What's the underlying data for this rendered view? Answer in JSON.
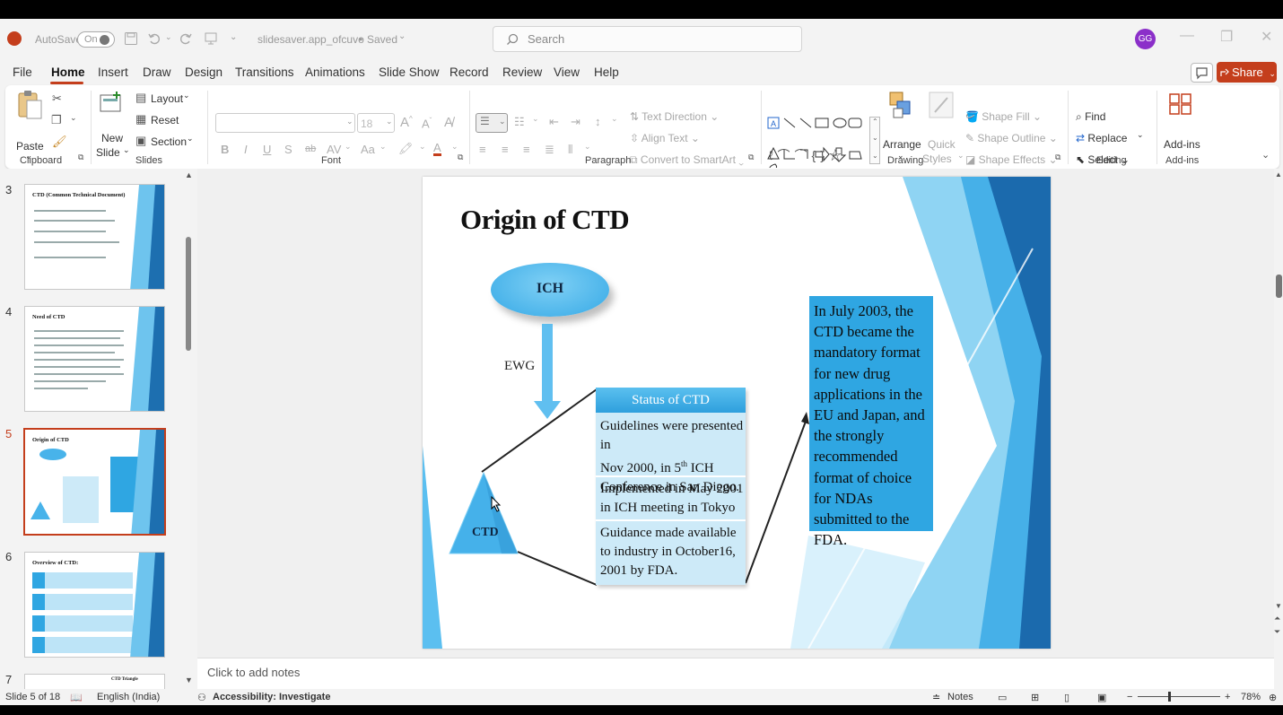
{
  "titlebar": {
    "autosave_label": "AutoSave",
    "autosave_state": "On",
    "filename": "slidesaver.app_ofcuvo",
    "save_status": "Saved",
    "search_placeholder": "Search",
    "user_initials": "GG"
  },
  "menu": {
    "items": [
      "File",
      "Home",
      "Insert",
      "Draw",
      "Design",
      "Transitions",
      "Animations",
      "Slide Show",
      "Record",
      "Review",
      "View",
      "Help"
    ],
    "active": "Home",
    "share_label": "Share"
  },
  "ribbon": {
    "clipboard": {
      "paste": "Paste",
      "group": "Clipboard"
    },
    "slides": {
      "new_slide_1": "New",
      "new_slide_2": "Slide",
      "layout": "Layout",
      "reset": "Reset",
      "section": "Section",
      "group": "Slides"
    },
    "font": {
      "size": "18",
      "bold": "B",
      "italic": "I",
      "underline": "U",
      "shadow": "S",
      "strike": "ab",
      "spacing": "AV",
      "case": "Aa",
      "color": "A",
      "group": "Font"
    },
    "paragraph": {
      "text_direction": "Text Direction",
      "align_text": "Align Text",
      "convert_smartart": "Convert to SmartArt",
      "group": "Paragraph"
    },
    "drawing": {
      "arrange": "Arrange",
      "quick_styles_1": "Quick",
      "quick_styles_2": "Styles",
      "shape_fill": "Shape Fill",
      "shape_outline": "Shape Outline",
      "shape_effects": "Shape Effects",
      "group": "Drawing"
    },
    "editing": {
      "find": "Find",
      "replace": "Replace",
      "select": "Select",
      "group": "Editing"
    },
    "addins": {
      "label": "Add-ins",
      "group": "Add-ins"
    }
  },
  "thumbnails": [
    {
      "num": "3",
      "title": "CTD (Common Technical Document)"
    },
    {
      "num": "4",
      "title": "Need of CTD"
    },
    {
      "num": "5",
      "title": "Origin of CTD"
    },
    {
      "num": "6",
      "title": "Overview of CTD:"
    },
    {
      "num": "7",
      "title": "CTD Triangle"
    }
  ],
  "slide": {
    "title": "Origin of CTD",
    "ich": "ICH",
    "ewg": "EWG",
    "ctd": "CTD",
    "status_header": "Status of CTD",
    "status_row1_a": "Guidelines were presented in",
    "status_row1_b": "Nov 2000, in 5",
    "status_row1_sup": "th",
    "status_row1_c": " ICH",
    "status_row1_d": "Conference in San Diego.",
    "status_row2": "Implemented in May 2001 in ICH meeting in Tokyo",
    "status_row3": "Guidance made available to industry in October16, 2001 by FDA.",
    "july_text": "In July 2003, the CTD became the mandatory format for new drug applications in the EU and Japan, and the strongly recommended format of choice for NDAs submitted to the FDA."
  },
  "notes_placeholder": "Click to add notes",
  "statusbar": {
    "slide_info": "Slide 5 of 18",
    "language": "English (India)",
    "accessibility": "Accessibility: Investigate",
    "notes": "Notes",
    "zoom": "78%"
  },
  "colors": {
    "accent": "#c43e1c",
    "slide_blue": "#2fa6e2",
    "status_fill": "#cdeaf8"
  }
}
